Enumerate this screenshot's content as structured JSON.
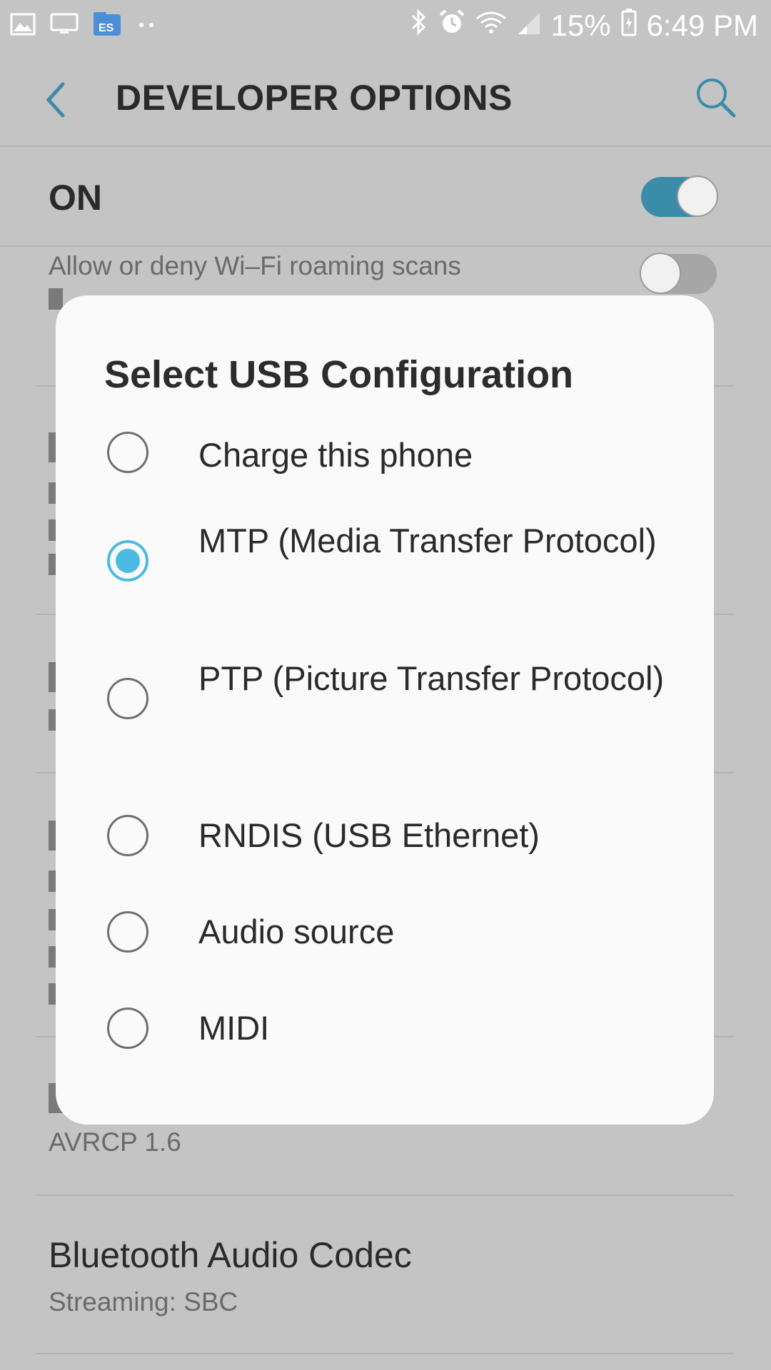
{
  "status_bar": {
    "icons_left": [
      "gallery-icon",
      "cast-screen-icon",
      "es-file-explorer-icon",
      "more-notifications-icon"
    ],
    "icons_right": [
      "bluetooth-icon",
      "alarm-icon",
      "wifi-icon",
      "signal-icon"
    ],
    "battery": "15%",
    "time": "6:49 PM"
  },
  "app_bar": {
    "title": "DEVELOPER OPTIONS",
    "back_icon": "chevron-left-icon",
    "search_icon": "search-icon"
  },
  "master_switch": {
    "label": "ON",
    "state": true
  },
  "background": {
    "roaming_text": "Allow or deny Wi–Fi roaming scans",
    "roaming_toggle": false,
    "avrcp_value": "AVRCP 1.6",
    "codec_title": "Bluetooth Audio Codec",
    "codec_value": "Streaming: SBC"
  },
  "dialog": {
    "title": "Select USB Configuration",
    "options": [
      {
        "label": "Charge this phone",
        "selected": false
      },
      {
        "label": "MTP (Media Transfer Protocol)",
        "selected": true
      },
      {
        "label": "PTP (Picture Transfer Protocol)",
        "selected": false
      },
      {
        "label": "RNDIS (USB Ethernet)",
        "selected": false
      },
      {
        "label": "Audio source",
        "selected": false
      },
      {
        "label": "MIDI",
        "selected": false
      }
    ]
  },
  "colors": {
    "accent": "#4cbbe2",
    "toggle_on": "#3a8ca8",
    "back_search": "#3a8ca8"
  }
}
